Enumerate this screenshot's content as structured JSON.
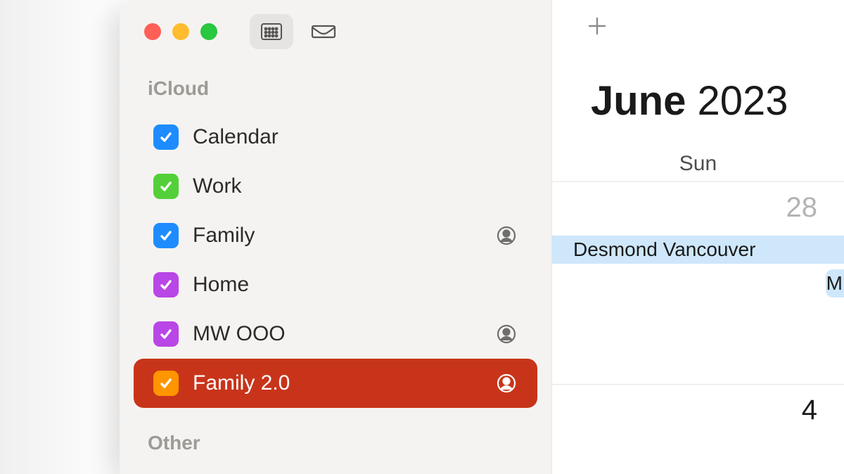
{
  "sidebar": {
    "sections": [
      {
        "name": "iCloud",
        "items": [
          {
            "label": "Calendar",
            "color": "#1e8cff",
            "shared": false,
            "selected": false
          },
          {
            "label": "Work",
            "color": "#53d039",
            "shared": false,
            "selected": false
          },
          {
            "label": "Family",
            "color": "#1e8cff",
            "shared": true,
            "selected": false
          },
          {
            "label": "Home",
            "color": "#b946e6",
            "shared": false,
            "selected": false
          },
          {
            "label": "MW OOO",
            "color": "#b946e6",
            "shared": true,
            "selected": false
          },
          {
            "label": "Family 2.0",
            "color": "#ff9500",
            "shared": true,
            "selected": true
          }
        ]
      },
      {
        "name": "Other",
        "items": []
      }
    ]
  },
  "main": {
    "month": "June",
    "year": "2023",
    "day_header": "Sun",
    "cells": [
      {
        "day": "28",
        "muted": true,
        "events": [
          {
            "title": "Desmond Vancouver",
            "type": "bar"
          },
          {
            "title": "M",
            "type": "chip"
          }
        ]
      },
      {
        "day": "4",
        "muted": false,
        "events": []
      }
    ]
  }
}
